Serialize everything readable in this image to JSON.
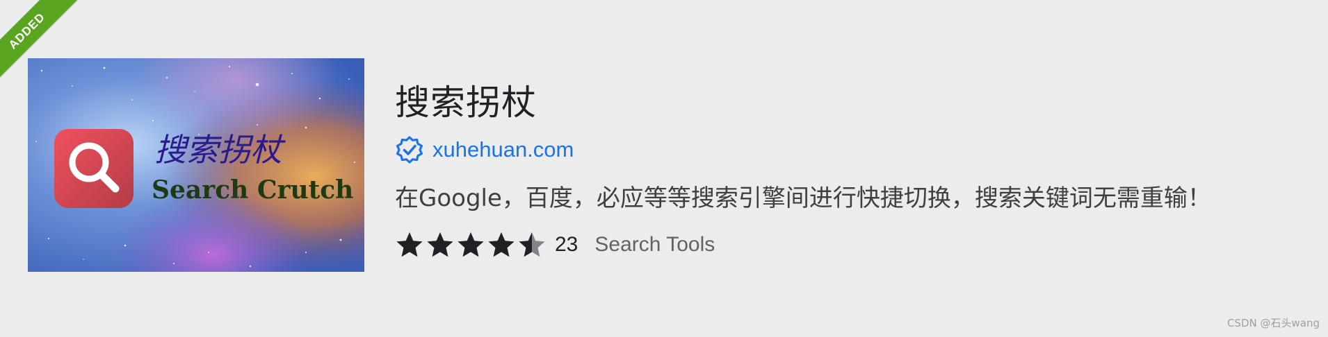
{
  "ribbon": {
    "label": "ADDED",
    "color": "#5aa51f"
  },
  "extension": {
    "title": "搜索拐杖",
    "publisher": "xuhehuan.com",
    "publisher_verified_icon": "verified-badge-icon",
    "description": "在Google，百度，必应等等搜索引擎间进行快捷切换，搜索关键词无需重输！",
    "rating": 4.5,
    "rating_max": 5,
    "rating_count": "23",
    "category": "Search Tools"
  },
  "image": {
    "logo_icon": "search-magnifier-icon",
    "title_cn": "搜索拐杖",
    "title_en": "Search Crutch"
  },
  "watermark": "CSDN @石头wang",
  "colors": {
    "accent": "#1a73e8",
    "star": "#202124",
    "star_empty": "#80868b",
    "logo_bg": "#f0505f"
  }
}
